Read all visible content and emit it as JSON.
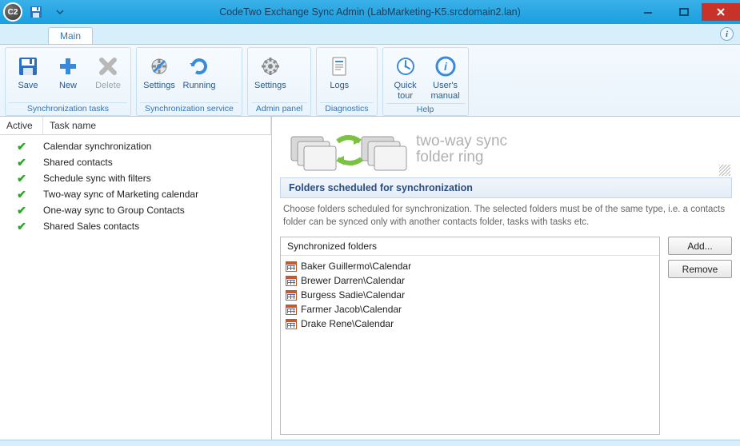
{
  "window": {
    "title": "CodeTwo Exchange Sync Admin (LabMarketing-K5.srcdomain2.lan)"
  },
  "ribbon": {
    "tab": "Main",
    "groups": [
      {
        "label": "Synchronization tasks",
        "buttons": [
          {
            "id": "save",
            "label": "Save"
          },
          {
            "id": "new",
            "label": "New"
          },
          {
            "id": "delete",
            "label": "Delete",
            "disabled": true
          }
        ]
      },
      {
        "label": "Synchronization service",
        "buttons": [
          {
            "id": "svc-settings",
            "label": "Settings"
          },
          {
            "id": "running",
            "label": "Running"
          }
        ]
      },
      {
        "label": "Admin panel",
        "buttons": [
          {
            "id": "adm-settings",
            "label": "Settings"
          }
        ]
      },
      {
        "label": "Diagnostics",
        "buttons": [
          {
            "id": "logs",
            "label": "Logs"
          }
        ]
      },
      {
        "label": "Help",
        "buttons": [
          {
            "id": "quick-tour",
            "label": "Quick\ntour"
          },
          {
            "id": "manual",
            "label": "User's\nmanual"
          }
        ]
      }
    ]
  },
  "tasklist": {
    "col_active": "Active",
    "col_name": "Task name",
    "rows": [
      {
        "active": true,
        "name": "Calendar synchronization"
      },
      {
        "active": true,
        "name": "Shared contacts"
      },
      {
        "active": true,
        "name": "Schedule sync with filters"
      },
      {
        "active": true,
        "name": "Two-way sync of Marketing calendar"
      },
      {
        "active": true,
        "name": "One-way sync to Group Contacts"
      },
      {
        "active": true,
        "name": "Shared Sales contacts"
      }
    ]
  },
  "details": {
    "banner_line1": "two-way sync",
    "banner_line2": "folder ring",
    "section_title": "Folders scheduled for synchronization",
    "section_desc": "Choose folders scheduled for synchronization. The selected folders must be of the same type, i.e. a contacts folder can be synced only with another contacts folder, tasks with tasks etc.",
    "list_header": "Synchronized folders",
    "folders": [
      "Baker Guillermo\\Calendar",
      "Brewer Darren\\Calendar",
      "Burgess Sadie\\Calendar",
      "Farmer Jacob\\Calendar",
      "Drake Rene\\Calendar"
    ],
    "add_label": "Add...",
    "remove_label": "Remove"
  }
}
